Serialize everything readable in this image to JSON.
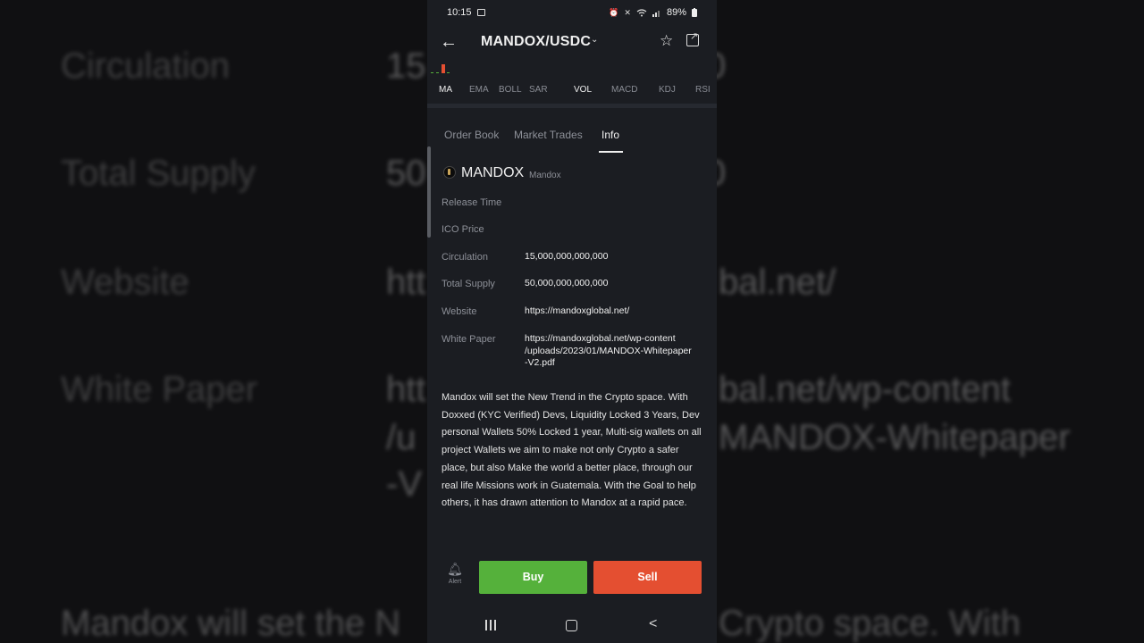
{
  "background": {
    "rows": [
      {
        "label": "Circulation",
        "value": "15"
      },
      {
        "label": "Total Supply",
        "value": "50"
      },
      {
        "label": "Website",
        "value": "htt"
      },
      {
        "label": "White Paper",
        "value": "htt"
      }
    ],
    "right_fragments": [
      "0",
      "0",
      "bal.net/",
      "bal.net/wp-content",
      "MANDOX-Whitepaper"
    ],
    "left_fragments": [
      "/u",
      "-V"
    ],
    "description_fragment": "Mandox will set the N",
    "description_fragment_right": "Crypto space. With"
  },
  "status_bar": {
    "time": "10:15",
    "battery": "89%",
    "icons": [
      "alarm-icon",
      "mute-icon",
      "wifi-icon",
      "signal-icon",
      "battery-icon"
    ]
  },
  "header": {
    "pair": "MANDOX/USDC"
  },
  "indicators": [
    "MA",
    "EMA",
    "BOLL",
    "SAR",
    "VOL",
    "MACD",
    "KDJ",
    "RSI"
  ],
  "tabs": [
    {
      "label": "Order Book",
      "active": false
    },
    {
      "label": "Market Trades",
      "active": false
    },
    {
      "label": "Info",
      "active": true
    }
  ],
  "coin": {
    "symbol": "MANDOX",
    "name": "Mandox"
  },
  "info": {
    "release_time_label": "Release Time",
    "release_time_value": "",
    "ico_price_label": "ICO Price",
    "ico_price_value": "",
    "circulation_label": "Circulation",
    "circulation_value": "15,000,000,000,000",
    "total_supply_label": "Total Supply",
    "total_supply_value": "50,000,000,000,000",
    "website_label": "Website",
    "website_value": "https://mandoxglobal.net/",
    "white_paper_label": "White Paper",
    "white_paper_line1": "https://mandoxglobal.net/wp-content",
    "white_paper_line2": "/uploads/2023/01/MANDOX-Whitepaper",
    "white_paper_line3": "-V2.pdf"
  },
  "description": "Mandox will set the New Trend in the Crypto space. With Doxxed (KYC Verified) Devs, Liquidity Locked 3 Years, Dev personal Wallets 50% Locked 1 year, Multi-sig wallets on all project Wallets we aim to make not only Crypto a safer place, but also Make the world a better place, through our real life Missions work in Guatemala. With the Goal to help others, it has drawn attention to Mandox at a rapid pace.",
  "actions": {
    "alert_label": "Alert",
    "buy_label": "Buy",
    "sell_label": "Sell"
  },
  "colors": {
    "buy": "#55b13b",
    "sell": "#e44f31",
    "background": "#1b1d22"
  }
}
